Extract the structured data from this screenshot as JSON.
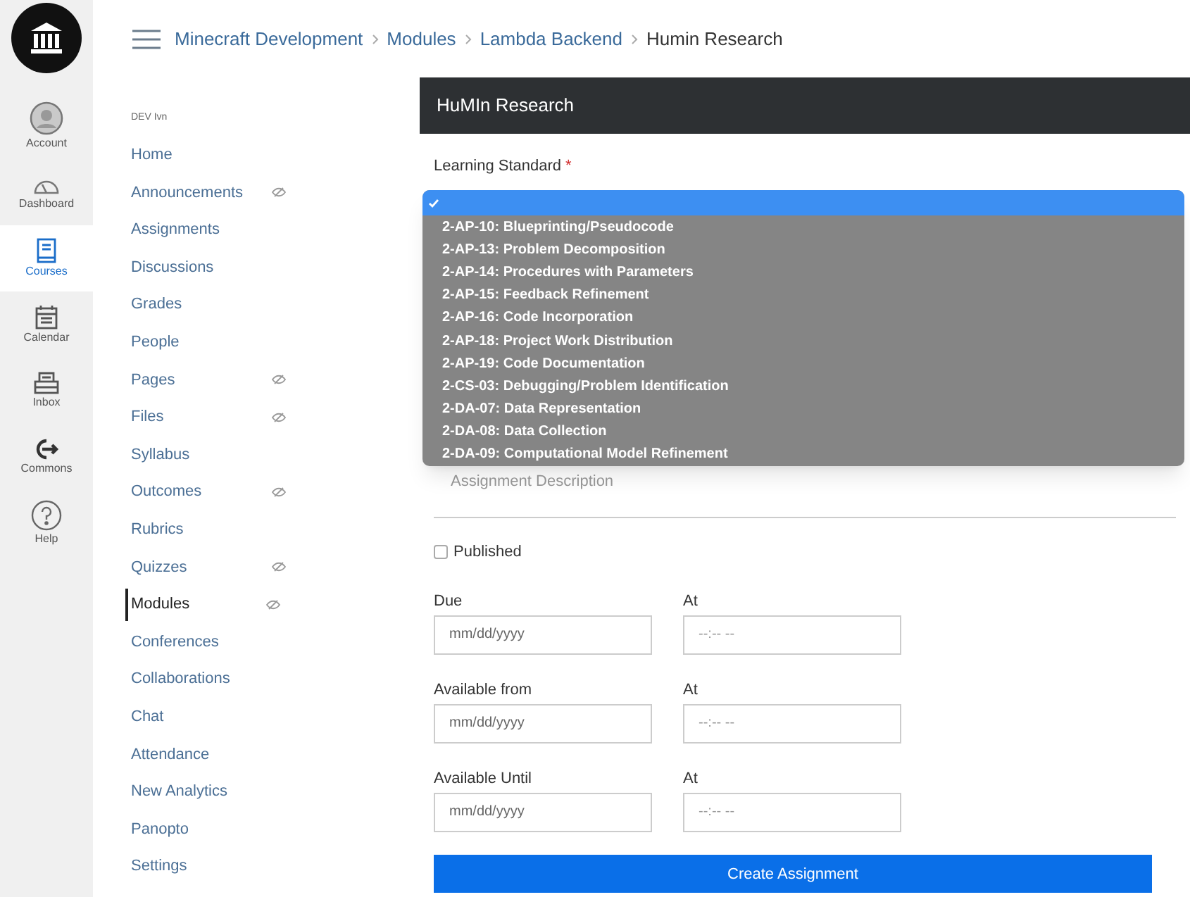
{
  "global_nav": [
    {
      "kind": "account",
      "label": "Account",
      "selected": false
    },
    {
      "kind": "dashboard",
      "label": "Dashboard",
      "selected": false
    },
    {
      "kind": "courses",
      "label": "Courses",
      "selected": true
    },
    {
      "kind": "calendar",
      "label": "Calendar",
      "selected": false
    },
    {
      "kind": "inbox",
      "label": "Inbox",
      "selected": false
    },
    {
      "kind": "commons",
      "label": "Commons",
      "selected": false
    },
    {
      "kind": "help",
      "label": "Help",
      "selected": false
    }
  ],
  "breadcrumbs": [
    {
      "label": "Minecraft Development",
      "current": false
    },
    {
      "label": "Modules",
      "current": false
    },
    {
      "label": "Lambda Backend",
      "current": false
    },
    {
      "label": "Humin Research",
      "current": true
    }
  ],
  "course_nav": {
    "term": "DEV Ivn",
    "items": [
      {
        "label": "Home",
        "hidden": false,
        "selected": false
      },
      {
        "label": "Announcements",
        "hidden": true,
        "selected": false
      },
      {
        "label": "Assignments",
        "hidden": false,
        "selected": false
      },
      {
        "label": "Discussions",
        "hidden": false,
        "selected": false
      },
      {
        "label": "Grades",
        "hidden": false,
        "selected": false
      },
      {
        "label": "People",
        "hidden": false,
        "selected": false
      },
      {
        "label": "Pages",
        "hidden": true,
        "selected": false
      },
      {
        "label": "Files",
        "hidden": true,
        "selected": false
      },
      {
        "label": "Syllabus",
        "hidden": false,
        "selected": false
      },
      {
        "label": "Outcomes",
        "hidden": true,
        "selected": false
      },
      {
        "label": "Rubrics",
        "hidden": false,
        "selected": false
      },
      {
        "label": "Quizzes",
        "hidden": true,
        "selected": false
      },
      {
        "label": "Modules",
        "hidden": true,
        "selected": true
      },
      {
        "label": "Conferences",
        "hidden": false,
        "selected": false
      },
      {
        "label": "Collaborations",
        "hidden": false,
        "selected": false
      },
      {
        "label": "Chat",
        "hidden": false,
        "selected": false
      },
      {
        "label": "Attendance",
        "hidden": false,
        "selected": false
      },
      {
        "label": "New Analytics",
        "hidden": false,
        "selected": false
      },
      {
        "label": "Panopto",
        "hidden": false,
        "selected": false
      },
      {
        "label": "Settings",
        "hidden": false,
        "selected": false
      }
    ]
  },
  "panel": {
    "title": "HuMIn Research",
    "standard_label": "Learning Standard",
    "required_mark": "*",
    "dropdown_options": [
      {
        "selected": true
      },
      {
        "label": "2-AP-10: Blueprinting/Pseudocode",
        "selected": false
      },
      {
        "label": "2-AP-13: Problem Decomposition",
        "selected": false
      },
      {
        "label": "2-AP-14: Procedures with Parameters",
        "selected": false
      },
      {
        "label": "2-AP-15: Feedback Refinement",
        "selected": false
      },
      {
        "label": "2-AP-16: Code Incorporation",
        "selected": false
      },
      {
        "label": "2-AP-18: Project Work Distribution",
        "selected": false
      },
      {
        "label": "2-AP-19: Code Documentation",
        "selected": false
      },
      {
        "label": "2-CS-03: Debugging/Problem Identification",
        "selected": false
      },
      {
        "label": "2-DA-07: Data Representation",
        "selected": false
      },
      {
        "label": "2-DA-08: Data Collection",
        "selected": false
      },
      {
        "label": "2-DA-09: Computational Model Refinement",
        "selected": false
      }
    ],
    "description_placeholder": "Assignment Description",
    "published": {
      "label": "Published",
      "checked": false
    },
    "dates": [
      {
        "label": "Due",
        "time_label": "At",
        "date_placeholder": "mm/dd/yyyy",
        "time_placeholder": "--:-- --"
      },
      {
        "label": "Available from",
        "time_label": "At",
        "date_placeholder": "mm/dd/yyyy",
        "time_placeholder": "--:-- --"
      },
      {
        "label": "Available Until",
        "time_label": "At",
        "date_placeholder": "mm/dd/yyyy",
        "time_placeholder": "--:-- --"
      }
    ],
    "submit": "Create Assignment"
  }
}
